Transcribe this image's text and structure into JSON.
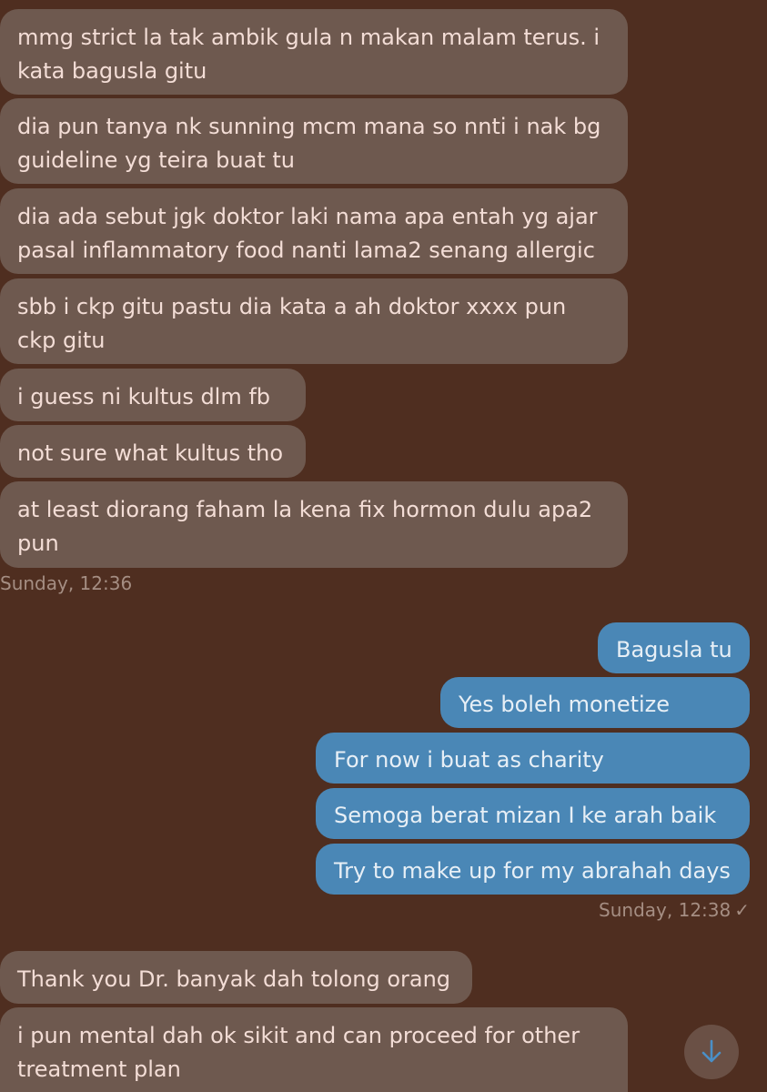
{
  "incoming_1": [
    "mmg strict la tak ambik gula n makan malam terus. i kata bagusla gitu",
    "dia pun tanya nk sunning mcm mana so nnti i nak bg guideline yg teira buat tu",
    "dia ada sebut jgk doktor laki nama apa entah yg ajar pasal inflammatory food nanti lama2 senang allergic",
    "sbb i ckp gitu pastu dia kata a ah doktor xxxx pun ckp gitu",
    "i guess ni kultus dlm fb",
    "not sure what kultus tho",
    "at least diorang faham la kena fix hormon dulu apa2 pun"
  ],
  "timestamp_1": "Sunday, 12:36",
  "outgoing": [
    "Bagusla tu",
    "Yes boleh monetize",
    "For now i buat as charity",
    "Semoga berat mizan I ke arah baik",
    "Try to make up for my abrahah days"
  ],
  "timestamp_2": "Sunday, 12:38",
  "read_mark": "✓",
  "incoming_2": [
    "Thank you Dr. banyak dah tolong orang",
    "i pun mental dah ok sikit and can proceed for other treatment plan"
  ],
  "colors": {
    "background": "#4f2e20",
    "incoming_bubble": "#6e594f",
    "outgoing_bubble": "#4a87b6"
  },
  "icons": {
    "scroll_down": "arrow-down-icon"
  }
}
